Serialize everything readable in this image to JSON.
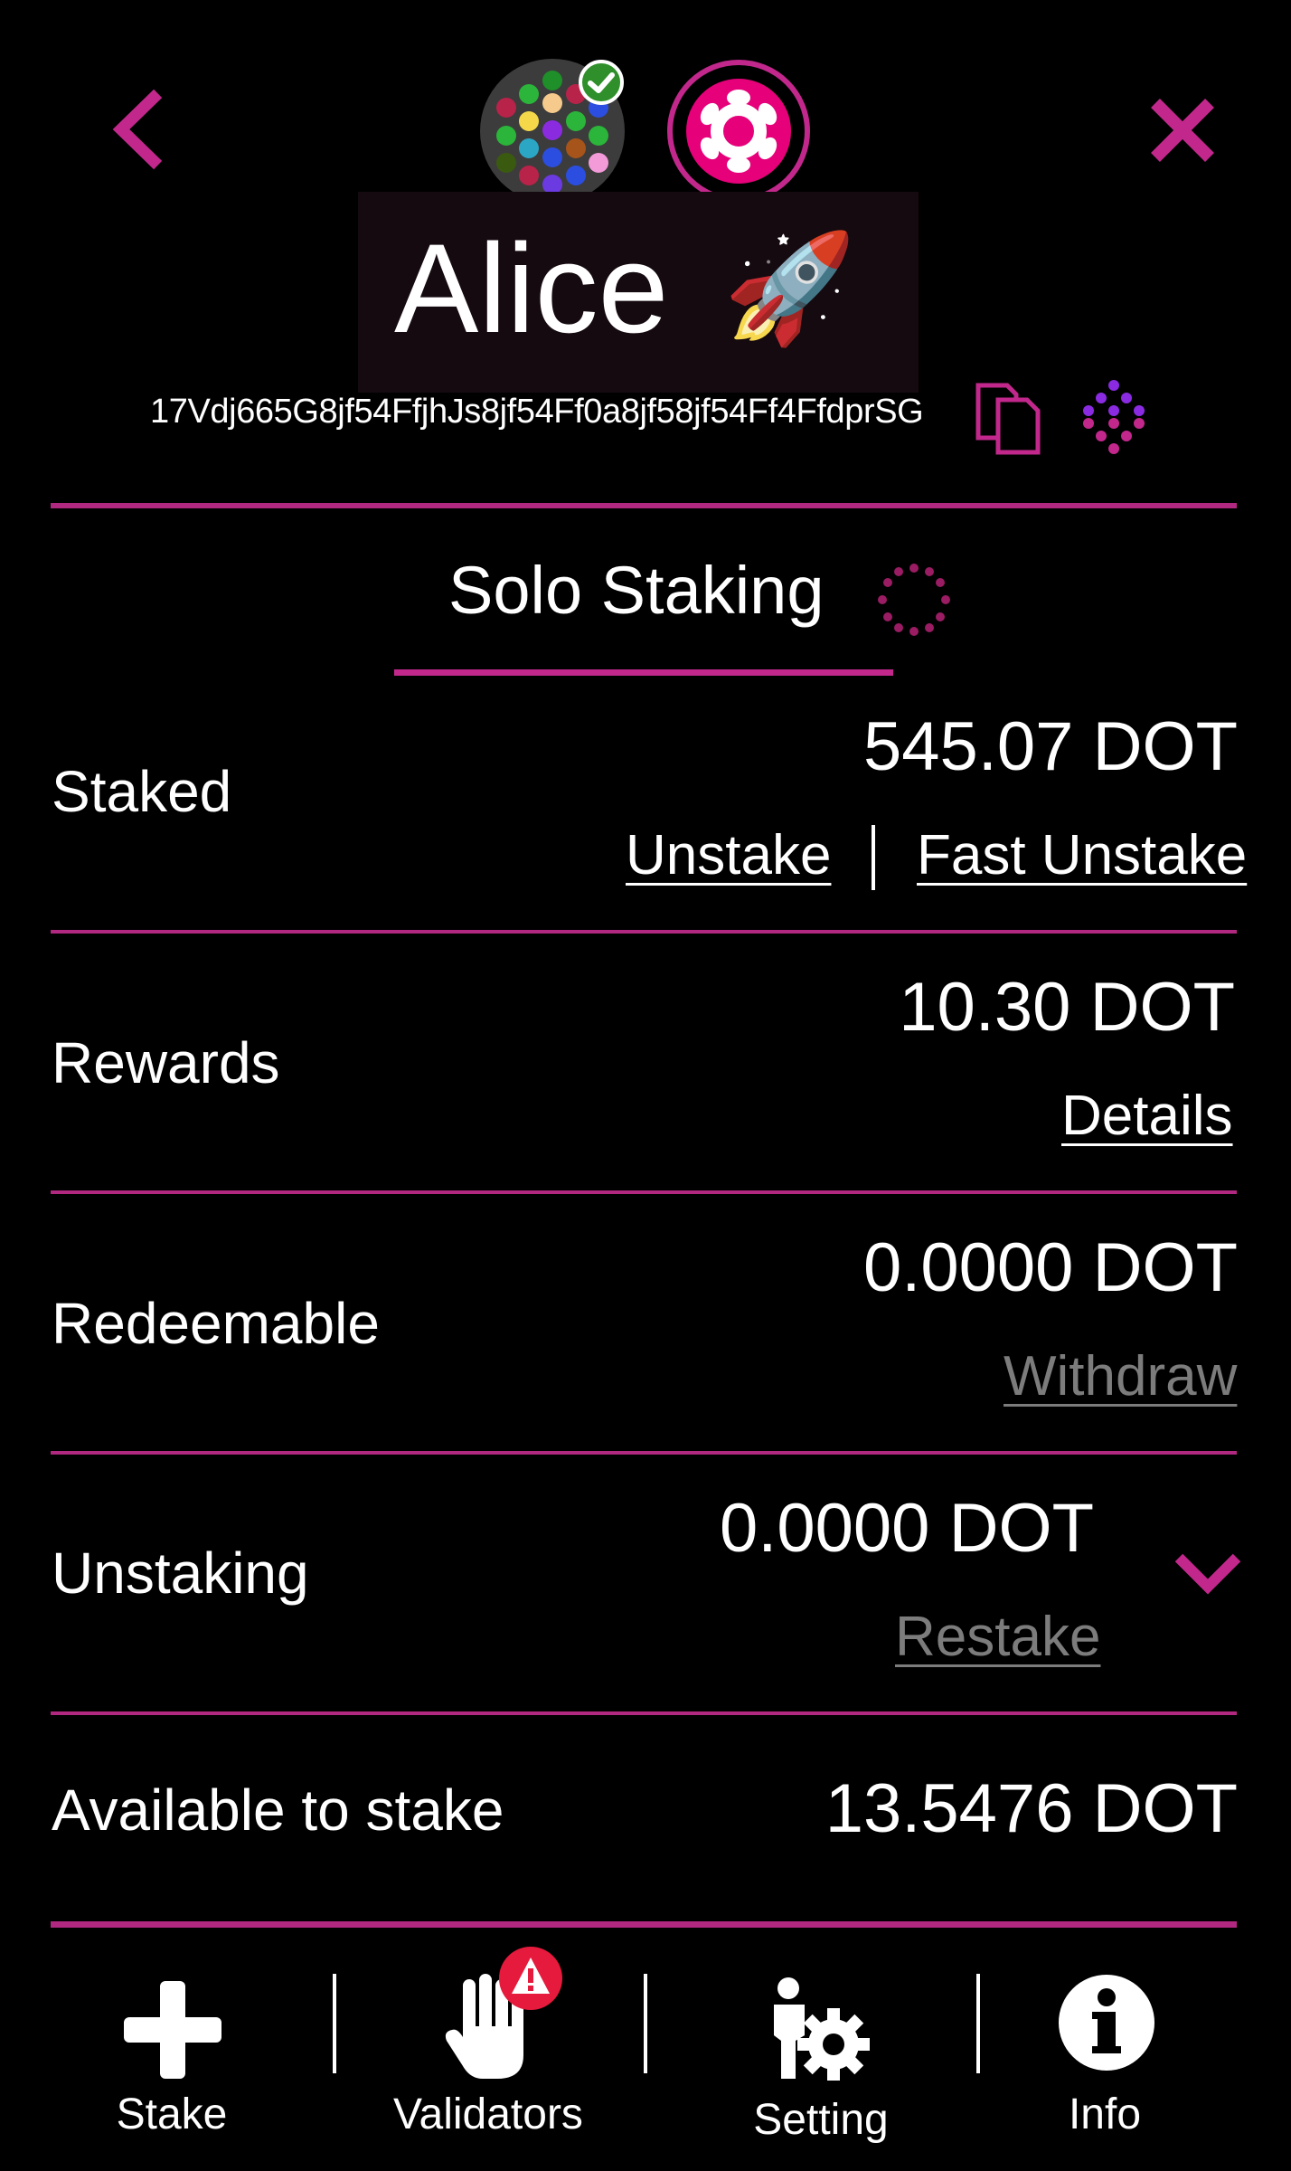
{
  "header": {
    "back_icon": "chevron-left-icon",
    "close_icon": "close-icon",
    "account_name": "Alice",
    "name_emoji": "🚀",
    "address": "17Vdj665G8jf54FfjhJs8jf54Ff0a8jf58jf54Ff4FfdprSG",
    "copy_icon": "copy-icon",
    "explorer_icon": "subscan-icon",
    "identicon_icon": "identicon-avatar",
    "verified_icon": "check-badge-icon",
    "chain_icon": "polkadot-logo-icon"
  },
  "title": {
    "text": "Solo Staking",
    "spinner_icon": "loading-spinner-icon"
  },
  "rows": {
    "staked": {
      "label": "Staked",
      "value": "545.07 DOT",
      "unstake": "Unstake",
      "fast_unstake": "Fast Unstake"
    },
    "rewards": {
      "label": "Rewards",
      "value": "10.30 DOT",
      "details": "Details"
    },
    "redeemable": {
      "label": "Redeemable",
      "value": "0.0000 DOT",
      "withdraw": "Withdraw"
    },
    "unstaking": {
      "label": "Unstaking",
      "value": "0.0000 DOT",
      "restake": "Restake",
      "expand_icon": "chevron-down-icon"
    },
    "available": {
      "label": "Available to stake",
      "value": "13.5476 DOT"
    }
  },
  "nav": {
    "stake": "Stake",
    "validators": "Validators",
    "setting": "Setting",
    "info": "Info",
    "validators_badge": "!"
  },
  "colors": {
    "accent": "#c2288c",
    "background": "#000000",
    "disabled": "#7c7c7c"
  }
}
